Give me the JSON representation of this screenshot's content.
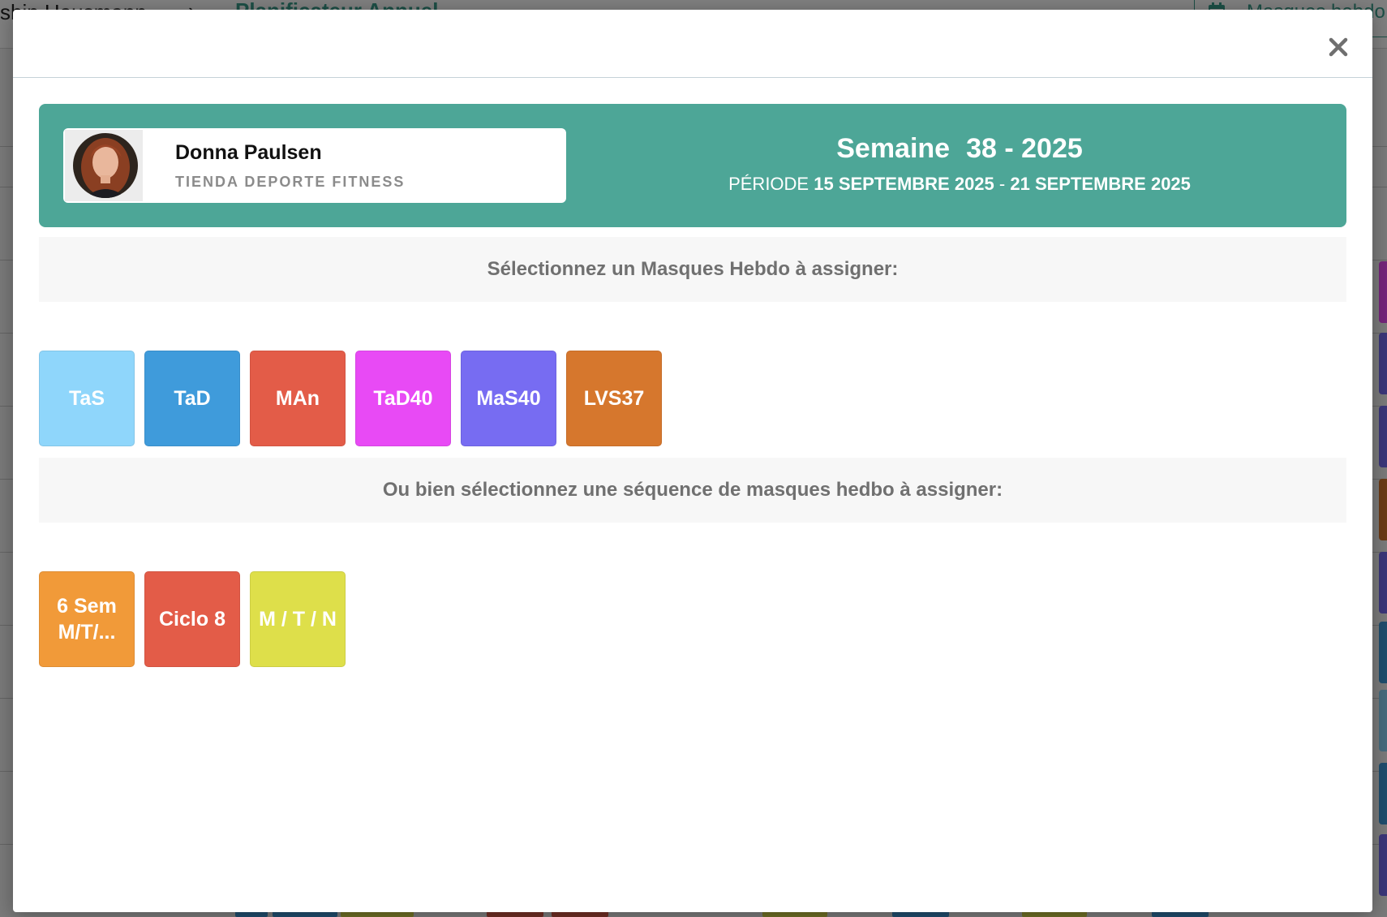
{
  "background": {
    "breadcrumb_user": "ship Hausmann",
    "breadcrumb_separator": "›",
    "breadcrumb_page": "Planificateur Annuel",
    "right_button_label": "Masques hebdo"
  },
  "modal": {
    "close_label": "×",
    "employee": {
      "name": "Donna Paulsen",
      "store": "TIENDA DEPORTE FITNESS"
    },
    "week": {
      "label": "Semaine",
      "value": "38 - 2025"
    },
    "period": {
      "label": "PÉRIODE",
      "start": "15 SEPTEMBRE 2025",
      "separator": "-",
      "end": "21 SEPTEMBRE 2025"
    },
    "masks_section_title": "Sélectionnez un Masques Hebdo à assigner:",
    "masks": [
      {
        "label": "TaS",
        "color": "#8fd6fb"
      },
      {
        "label": "TaD",
        "color": "#3f9bdb"
      },
      {
        "label": "MAn",
        "color": "#e35c48"
      },
      {
        "label": "TaD40",
        "color": "#e84af5"
      },
      {
        "label": "MaS40",
        "color": "#776cf2"
      },
      {
        "label": "LVS37",
        "color": "#d6772d"
      }
    ],
    "sequences_section_title": "Ou bien sélectionnez une séquence de masques hedbo à assigner:",
    "sequences": [
      {
        "label": "6 Sem M/T/...",
        "color": "#f19a39"
      },
      {
        "label": "Ciclo 8",
        "color": "#e35c48"
      },
      {
        "label": "M / T / N",
        "color": "#dedf4a"
      }
    ]
  }
}
